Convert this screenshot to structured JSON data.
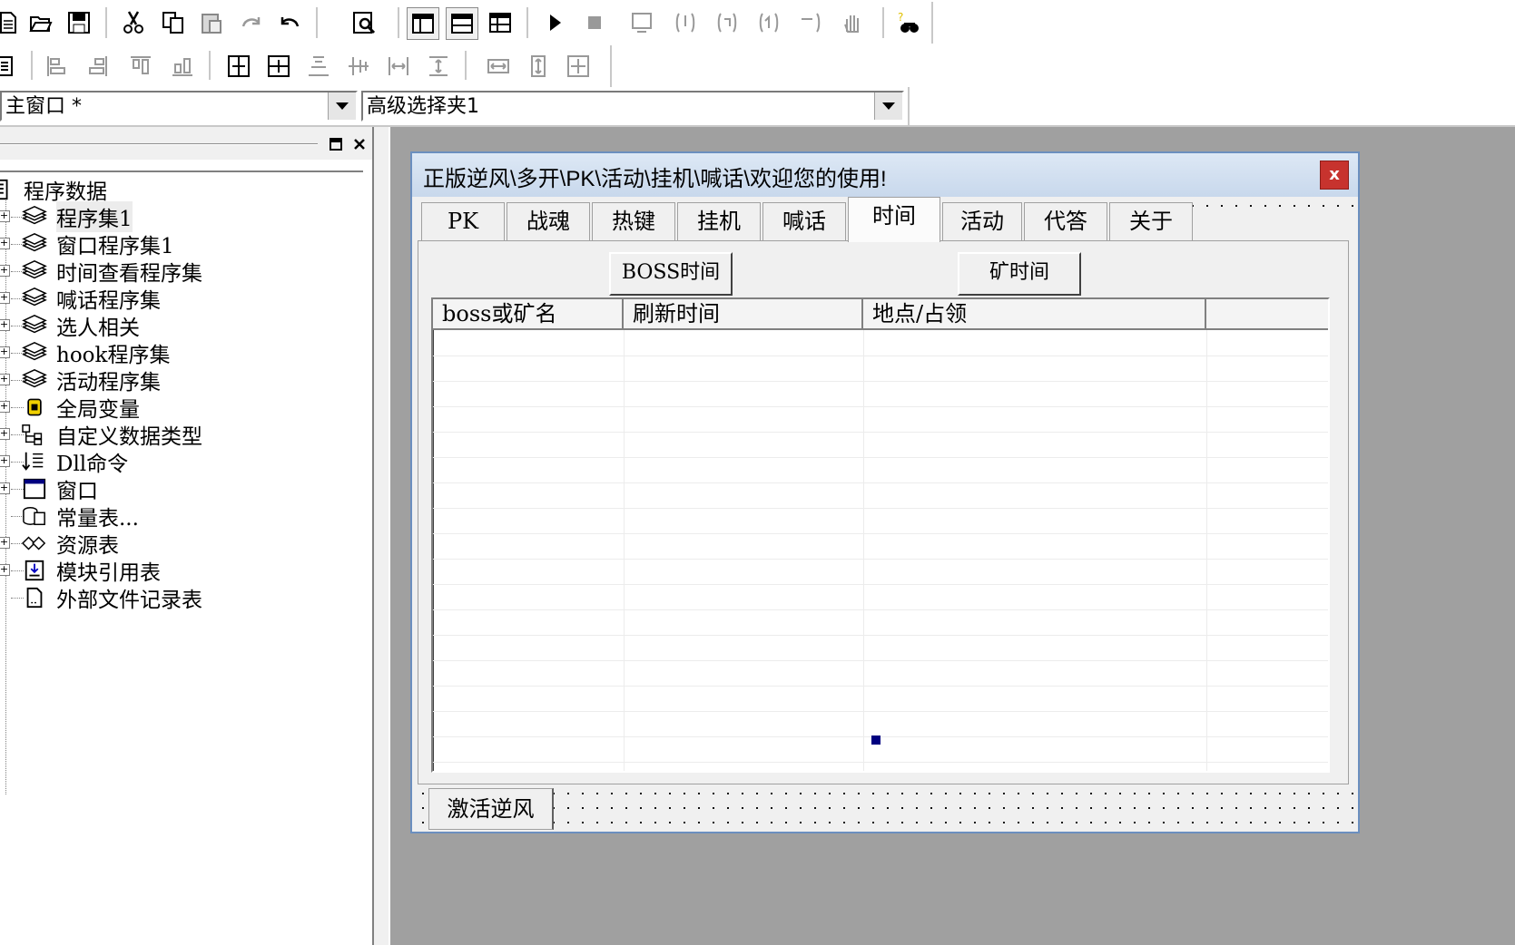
{
  "toolbar_top": {
    "icons": [
      "new-document-icon",
      "open-folder-icon",
      "save-icon",
      "cut-icon",
      "copy-icon",
      "paste-icon",
      "redo-icon",
      "undo-icon",
      "find-icon",
      "layout-window-icon",
      "layout-tab-icon",
      "layout-grid-icon",
      "run-icon",
      "stop-icon",
      "step-icon",
      "step-into-icon",
      "step-over-icon",
      "step-out-icon",
      "return-icon",
      "hand-icon",
      "search-help-icon"
    ]
  },
  "toolbar_align": {
    "icons": [
      "align-tool-icon",
      "align-left-icon",
      "align-right-icon",
      "align-top-icon",
      "align-bottom-icon",
      "center-horizontal-icon",
      "center-vertical-icon",
      "distribute-top-icon",
      "distribute-middle-icon",
      "equal-spacing-h-icon",
      "equal-spacing-v-icon",
      "same-width-icon",
      "same-height-icon",
      "same-size-icon"
    ]
  },
  "combos": {
    "window_select": "主窗口 *",
    "control_select": "高级选择夹1"
  },
  "tree": {
    "root": "程序数据",
    "items": [
      {
        "label": "程序集1",
        "icon": "module-icon",
        "expand": "+"
      },
      {
        "label": "窗口程序集1",
        "icon": "module-icon",
        "expand": "+"
      },
      {
        "label": "时间查看程序集",
        "icon": "module-icon",
        "expand": "+"
      },
      {
        "label": "喊话程序集",
        "icon": "module-icon",
        "expand": "+"
      },
      {
        "label": "选人相关",
        "icon": "module-icon",
        "expand": "+"
      },
      {
        "label": "hook程序集",
        "icon": "module-icon",
        "expand": "+"
      },
      {
        "label": "活动程序集",
        "icon": "module-icon",
        "expand": "+"
      },
      {
        "label": "全局变量",
        "icon": "global-variable-icon",
        "expand": "+"
      },
      {
        "label": "自定义数据类型",
        "icon": "data-type-icon",
        "expand": "+"
      },
      {
        "label": "Dll命令",
        "icon": "dll-command-icon",
        "expand": "+"
      },
      {
        "label": "窗口",
        "icon": "window-icon",
        "expand": "+"
      },
      {
        "label": "常量表...",
        "icon": "constant-table-icon",
        "expand": ""
      },
      {
        "label": "资源表",
        "icon": "resource-table-icon",
        "expand": "+"
      },
      {
        "label": "模块引用表",
        "icon": "module-ref-icon",
        "expand": "+"
      },
      {
        "label": "外部文件记录表",
        "icon": "external-file-icon",
        "expand": ""
      }
    ]
  },
  "dialog": {
    "title": "正版逆风\\多开\\PK\\活动\\挂机\\喊话\\欢迎您的使用!",
    "close_label": "x",
    "tabs": [
      "PK",
      "战魂",
      "热键",
      "挂机",
      "喊话",
      "时间",
      "活动",
      "代答",
      "关于"
    ],
    "active_tab": "时间",
    "boss_button": "BOSS时间",
    "mine_button": "矿时间",
    "columns": [
      "boss或矿名",
      "刷新时间",
      "地点/占领",
      ""
    ],
    "bottom_tab": "激活逆风"
  },
  "colors": {
    "workspace": "#a0a0a0",
    "close_button": "#c7332e",
    "selection_handle": "#000080"
  }
}
